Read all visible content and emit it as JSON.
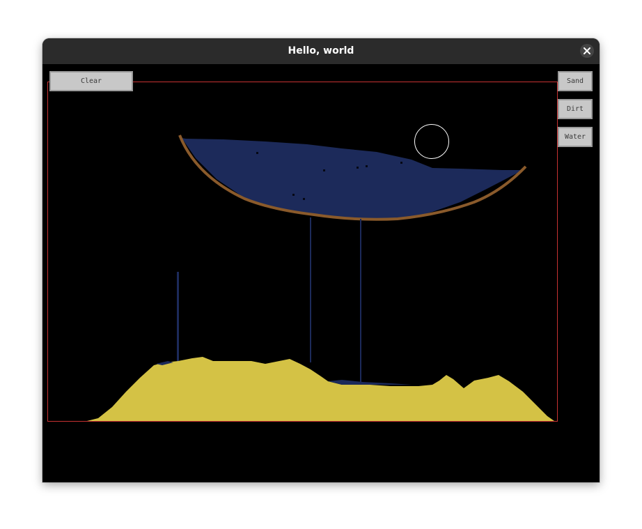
{
  "window": {
    "title": "Hello, world"
  },
  "buttons": {
    "clear": "Clear",
    "sand": "Sand",
    "dirt": "Dirt",
    "water": "Water"
  },
  "icons": {
    "close": "close-icon",
    "brush_cursor": "circle-cursor-icon"
  },
  "colors": {
    "sand": "#d4c245",
    "dirt": "#8a5a2b",
    "water": "#1c2a5a",
    "border": "#c83232",
    "titlebar": "#2b2b2b"
  }
}
